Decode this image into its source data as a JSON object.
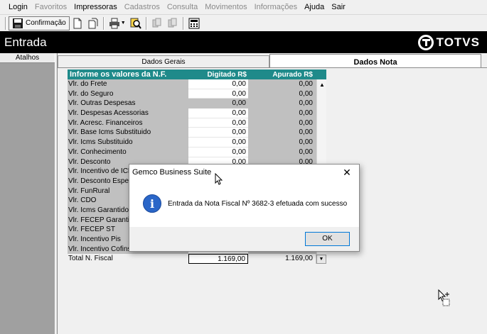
{
  "menu": {
    "items": [
      {
        "label": "Login",
        "enabled": true
      },
      {
        "label": "Favoritos",
        "enabled": false
      },
      {
        "label": "Impressoras",
        "enabled": true
      },
      {
        "label": "Cadastros",
        "enabled": false
      },
      {
        "label": "Consulta",
        "enabled": false
      },
      {
        "label": "Movimentos",
        "enabled": false
      },
      {
        "label": "Informações",
        "enabled": false
      },
      {
        "label": "Ajuda",
        "enabled": true
      },
      {
        "label": "Sair",
        "enabled": true
      }
    ]
  },
  "toolbar": {
    "confirm_label": "Confirmação"
  },
  "header": {
    "title": "Entrada",
    "logo_text": "TOTVS"
  },
  "sidebar": {
    "tab_label": "Atalhos"
  },
  "tabs": {
    "gerais": "Dados Gerais",
    "nota": "Dados Nota"
  },
  "grid": {
    "title": "Informe os valores da N.F.",
    "col_digitado": "Digitado  R$",
    "col_apurado": "Apurado  R$",
    "rows": [
      {
        "label": "Vlr. do Frete",
        "digitado": "0,00",
        "apurado": "0,00",
        "editable": true
      },
      {
        "label": "Vlr. do Seguro",
        "digitado": "0,00",
        "apurado": "0,00",
        "editable": true
      },
      {
        "label": "Vlr. Outras Despesas",
        "digitado": "0,00",
        "apurado": "0,00",
        "editable": false
      },
      {
        "label": "Vlr. Despesas Acessorias",
        "digitado": "0,00",
        "apurado": "0,00",
        "editable": true
      },
      {
        "label": "Vlr. Acresc. Financeiros",
        "digitado": "0,00",
        "apurado": "0,00",
        "editable": true
      },
      {
        "label": "Vlr. Base Icms Substituido",
        "digitado": "0,00",
        "apurado": "0,00",
        "editable": true
      },
      {
        "label": "Vlr. Icms Substituido",
        "digitado": "0,00",
        "apurado": "0,00",
        "editable": true
      },
      {
        "label": "Vlr. Conhecimento",
        "digitado": "0,00",
        "apurado": "0,00",
        "editable": true
      },
      {
        "label": "Vlr. Desconto",
        "digitado": "0,00",
        "apurado": "0,00",
        "editable": true
      },
      {
        "label": "Vlr. Incentivo de ICMS",
        "digitado": "",
        "apurado": "",
        "editable": true
      },
      {
        "label": "Vlr. Desconto Especial",
        "digitado": "",
        "apurado": "",
        "editable": true
      },
      {
        "label": "Vlr. FunRural",
        "digitado": "",
        "apurado": "",
        "editable": true
      },
      {
        "label": "Vlr. CDO",
        "digitado": "",
        "apurado": "",
        "editable": true
      },
      {
        "label": "Vlr. Icms Garantido",
        "digitado": "",
        "apurado": "",
        "editable": true
      },
      {
        "label": "Vlr. FECEP Garantido",
        "digitado": "",
        "apurado": "",
        "editable": true
      },
      {
        "label": "Vlr. FECEP ST",
        "digitado": "",
        "apurado": "",
        "editable": true
      },
      {
        "label": "Vlr. Incentivo Pis",
        "digitado": "",
        "apurado": "",
        "editable": true
      },
      {
        "label": "Vlr. Incentivo Cofins",
        "digitado": "",
        "apurado": "",
        "editable": true
      }
    ],
    "total": {
      "label": "Total N. Fiscal",
      "digitado": "1.169,00",
      "apurado": "1.169,00"
    }
  },
  "dialog": {
    "title": "Gemco Business Suite",
    "message": "Entrada da Nota Fiscal Nº 3682-3  efetuada com sucesso",
    "ok_label": "OK",
    "icon": "info-icon"
  },
  "colors": {
    "grid_header": "#1f8a8a",
    "header_band": "#000000",
    "dialog_focus": "#0078d7"
  }
}
